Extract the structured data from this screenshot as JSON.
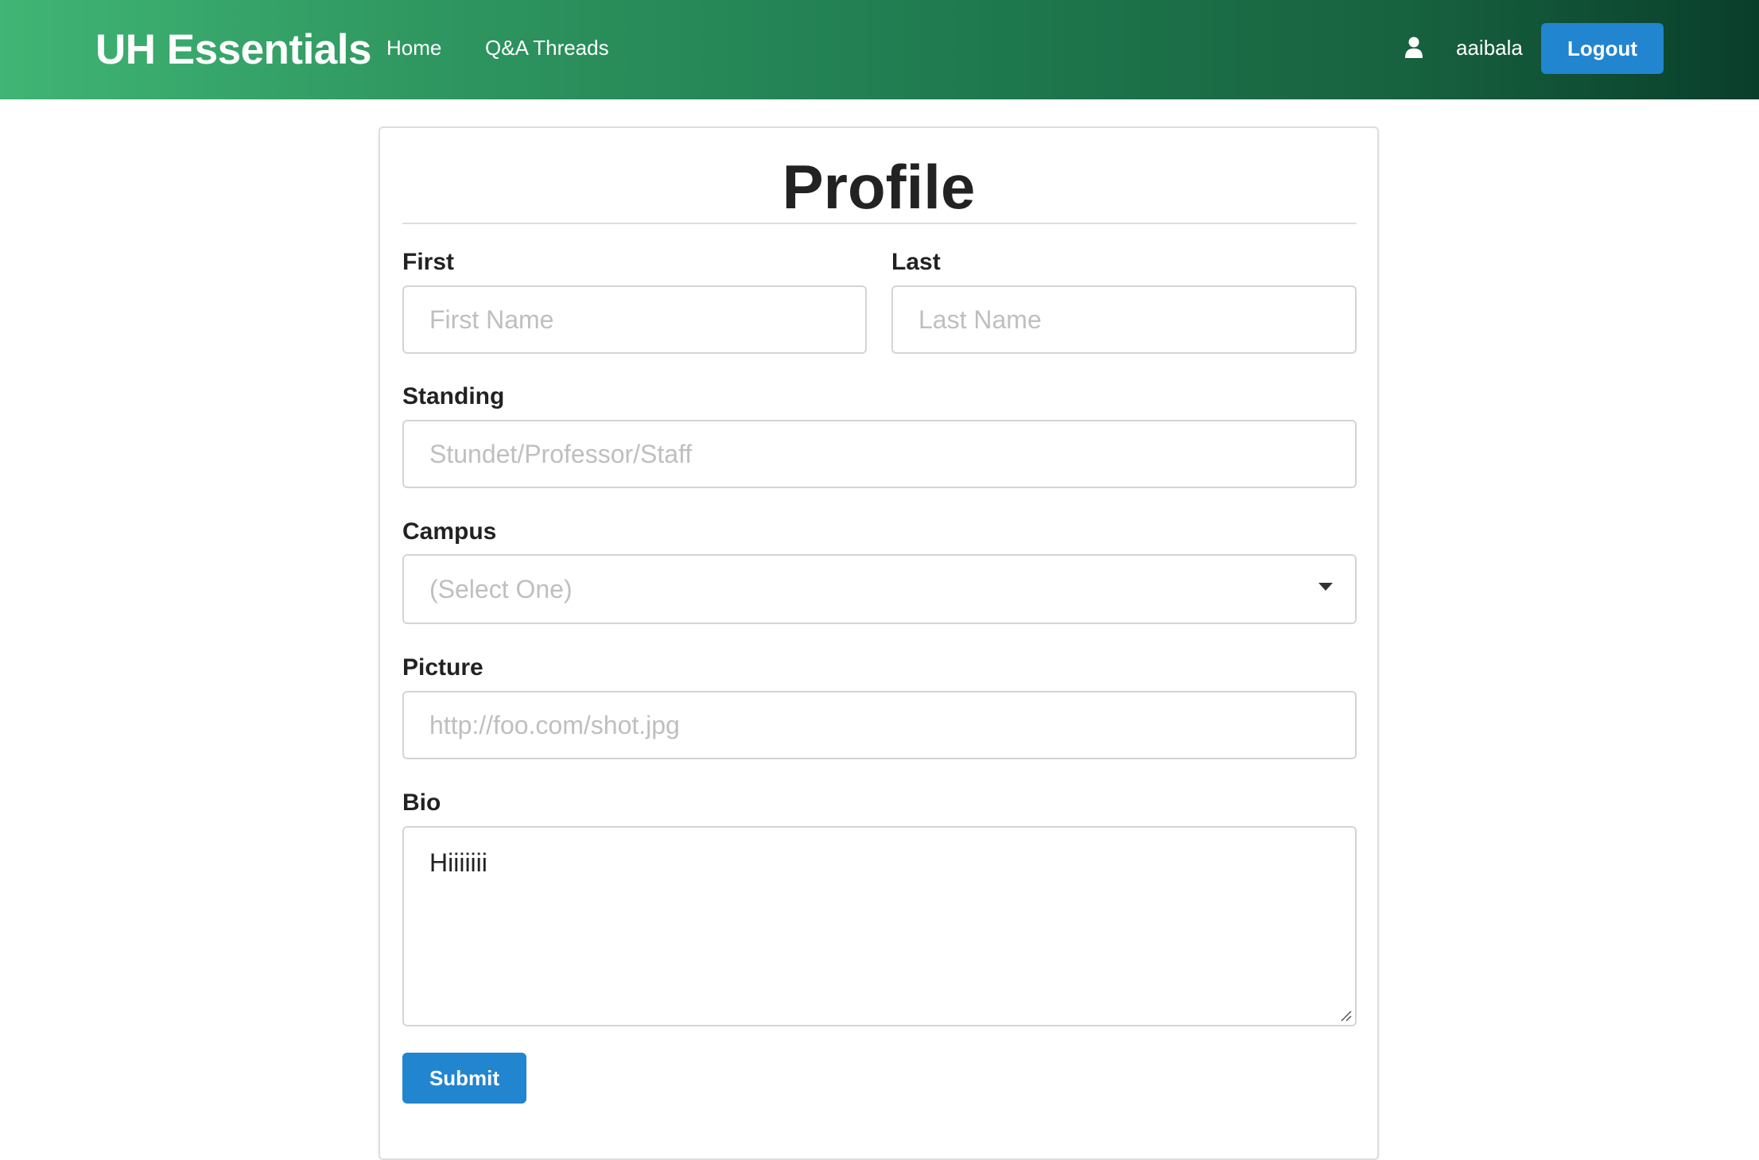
{
  "navbar": {
    "brand": "UH Essentials",
    "links": [
      {
        "label": "Home"
      },
      {
        "label": "Q&A Threads"
      }
    ],
    "user_icon": "user-icon",
    "username": "aaibala",
    "logout_label": "Logout"
  },
  "form": {
    "title": "Profile",
    "first": {
      "label": "First",
      "placeholder": "First Name",
      "value": ""
    },
    "last": {
      "label": "Last",
      "placeholder": "Last Name",
      "value": ""
    },
    "standing": {
      "label": "Standing",
      "placeholder": "Stundet/Professor/Staff",
      "value": ""
    },
    "campus": {
      "label": "Campus",
      "selected": "(Select One)",
      "icon": "dropdown-icon"
    },
    "picture": {
      "label": "Picture",
      "placeholder": "http://foo.com/shot.jpg",
      "value": ""
    },
    "bio": {
      "label": "Bio",
      "value": "Hiiiiiii"
    },
    "submit_label": "Submit"
  },
  "colors": {
    "navbar_gradient_start": "#40b574",
    "navbar_gradient_end": "#093e2b",
    "button_blue": "#2185d0",
    "placeholder_gray": "#bfbfbf"
  }
}
